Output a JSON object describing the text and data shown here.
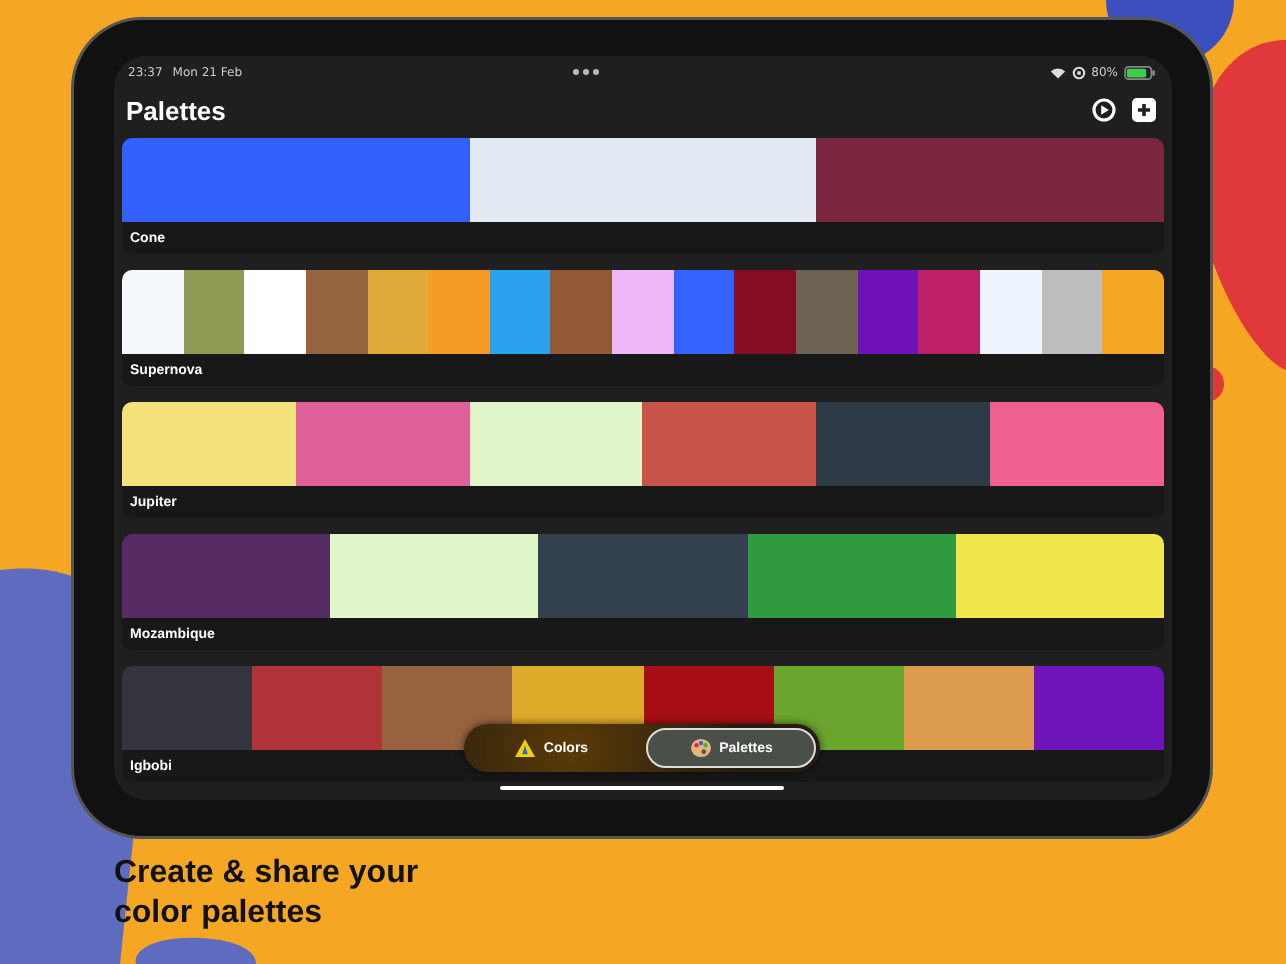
{
  "status_bar": {
    "time": "23:37",
    "date": "Mon 21 Feb",
    "battery": "80%"
  },
  "header": {
    "title": "Palettes"
  },
  "palettes": [
    {
      "name": "Cone",
      "swatches": [
        {
          "color": "#3461fd"
        },
        {
          "color": "#e2e9f3"
        },
        {
          "color": "#7b2740"
        }
      ]
    },
    {
      "name": "Supernova",
      "swatches": [
        {
          "color": "#f5f8fd"
        },
        {
          "color": "#8f9a55"
        },
        {
          "color": "#ffffff"
        },
        {
          "color": "#95643f"
        },
        {
          "color": "#e0a93a"
        },
        {
          "color": "#f59c25"
        },
        {
          "color": "#29a1ec"
        },
        {
          "color": "#925837"
        },
        {
          "color": "#eeb8f8"
        },
        {
          "color": "#3362fc"
        },
        {
          "color": "#850d22"
        },
        {
          "color": "#6d6352"
        },
        {
          "color": "#6f11b9"
        },
        {
          "color": "#bd2068"
        },
        {
          "color": "#eef4fd"
        },
        {
          "color": "#bdbdbd"
        },
        {
          "color": "#f5a623"
        }
      ]
    },
    {
      "name": "Jupiter",
      "swatches": [
        {
          "color": "#f5e27a"
        },
        {
          "color": "#e0609a"
        },
        {
          "color": "#e0f5c8"
        },
        {
          "color": "#c9554a"
        },
        {
          "color": "#2f3a47"
        },
        {
          "color": "#ef5f8f"
        }
      ]
    },
    {
      "name": "Mozambique",
      "swatches": [
        {
          "color": "#562a63"
        },
        {
          "color": "#e0f5c8"
        },
        {
          "color": "#33404d"
        },
        {
          "color": "#2f9a3e"
        },
        {
          "color": "#f0e74e"
        }
      ]
    },
    {
      "name": "Igbobi",
      "swatches": [
        {
          "color": "#34343e"
        },
        {
          "color": "#b03438"
        },
        {
          "color": "#99623f"
        },
        {
          "color": "#ddaa2a"
        },
        {
          "color": "#a60e14"
        },
        {
          "color": "#6aa52e"
        },
        {
          "color": "#dd9b4f"
        },
        {
          "color": "#6f14b8"
        }
      ]
    }
  ],
  "tabs": [
    {
      "label": "Colors",
      "kind": "colors",
      "selected": false
    },
    {
      "label": "Palettes",
      "kind": "palettes",
      "selected": true
    }
  ],
  "caption": "Create & share your color palettes"
}
